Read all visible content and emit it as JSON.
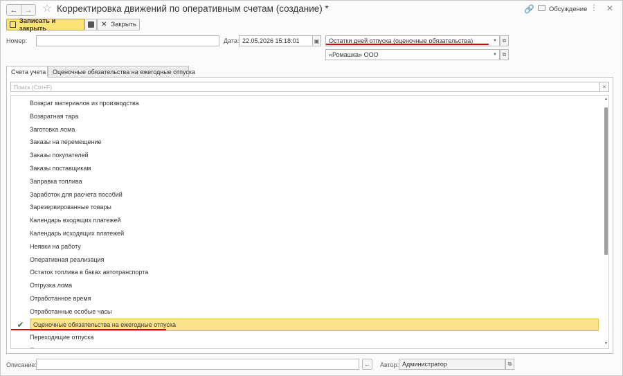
{
  "window": {
    "title": "Корректировка движений по оперативным счетам (создание) *",
    "discuss_label": "Обсуждение"
  },
  "toolbar": {
    "save_close_label": "Записать и закрыть",
    "close_label": "Закрыть"
  },
  "header": {
    "number_label": "Номер:",
    "number_value": "",
    "date_label": "Дата:",
    "date_value": "22.05.2026 15:18:01",
    "operation_value": "Остатки дней отпуска (оценочные обязательства)",
    "organization_value": "«Ромашка» ООО"
  },
  "tabs": [
    {
      "label": "Счета учета",
      "active": true
    },
    {
      "label": "Оценочные обязательства на ежегодные отпуска",
      "active": false
    }
  ],
  "search": {
    "placeholder": "Поиск (Ctrl+F)"
  },
  "list": {
    "items": [
      {
        "label": "Возврат материалов из производства",
        "checked": false
      },
      {
        "label": "Возвратная тара",
        "checked": false
      },
      {
        "label": "Заготовка лома",
        "checked": false
      },
      {
        "label": "Заказы на перемещение",
        "checked": false
      },
      {
        "label": "Заказы покупателей",
        "checked": false
      },
      {
        "label": "Заказы поставщикам",
        "checked": false
      },
      {
        "label": "Заправка топлива",
        "checked": false
      },
      {
        "label": "Заработок для расчета пособий",
        "checked": false
      },
      {
        "label": "Зарезервированные товары",
        "checked": false
      },
      {
        "label": "Календарь входящих платежей",
        "checked": false
      },
      {
        "label": "Календарь исходящих платежей",
        "checked": false
      },
      {
        "label": "Неявки на работу",
        "checked": false
      },
      {
        "label": "Оперативная реализация",
        "checked": false
      },
      {
        "label": "Остаток топлива в баках автотранспорта",
        "checked": false
      },
      {
        "label": "Отгрузка лома",
        "checked": false
      },
      {
        "label": "Отработанное время",
        "checked": false
      },
      {
        "label": "Отработанные особые часы",
        "checked": false
      },
      {
        "label": "Оценочные обязательства на ежегодные отпуска",
        "checked": true,
        "selected": true
      },
      {
        "label": "Переходящие отпуска",
        "checked": false
      },
      {
        "label": "Покупки",
        "checked": false
      }
    ]
  },
  "footer": {
    "description_label": "Описание:",
    "description_value": "",
    "author_label": "Автор:",
    "author_value": "Администратор"
  },
  "colors": {
    "accent_yellow": "#fbe374",
    "selected_row": "#fbe38e",
    "check_green": "#2e7d32",
    "highlight_red": "#e00000"
  }
}
